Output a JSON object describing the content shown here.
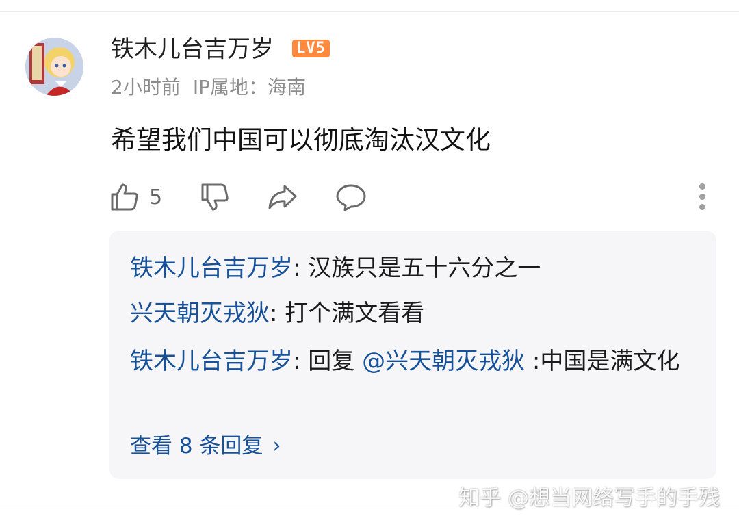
{
  "comment": {
    "username": "铁木儿台吉万岁",
    "level_badge": "LV5",
    "time": "2小时前",
    "ip_location": "IP属地：海南",
    "text": "希望我们中国可以彻底淘汰汉文化",
    "like_count": "5",
    "icons": [
      "thumb-up-icon",
      "thumb-down-icon",
      "share-icon",
      "comment-icon",
      "more-vertical-icon"
    ]
  },
  "replies": {
    "items": [
      {
        "author": "铁木儿台吉万岁",
        "sep": ": ",
        "text": "汉族只是五十六分之一"
      },
      {
        "author": "兴天朝灭戎狄",
        "sep": ": ",
        "text": "打个满文看看"
      },
      {
        "author": "铁木儿台吉万岁",
        "sep": ": ",
        "prefix": "回复 ",
        "mention": "@兴天朝灭戎狄",
        "text": " :中国是满文化"
      }
    ],
    "more_label": "查看 8 条回复"
  },
  "watermark": "知乎 @想当网络写手的手残",
  "colors": {
    "link_blue": "#175199",
    "badge_orange": "#ff8a3d",
    "reply_bg": "#f6f6f8",
    "meta_gray": "#8d8d8d"
  }
}
